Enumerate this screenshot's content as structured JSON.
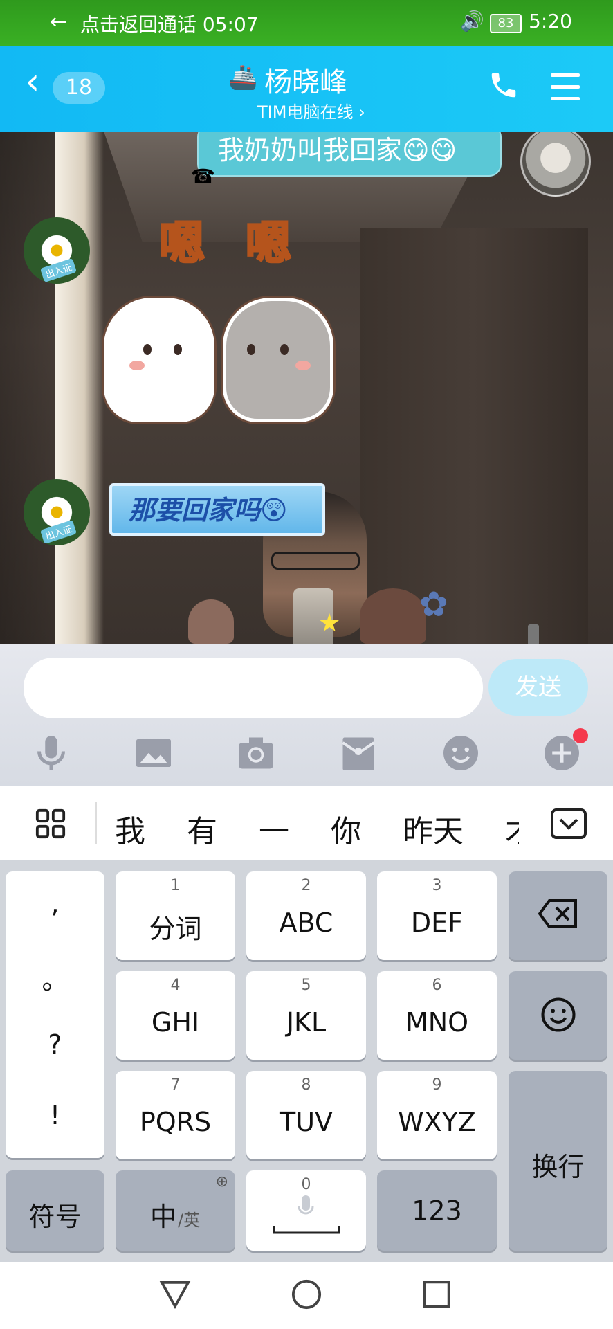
{
  "status_bar": {
    "call_back": "点击返回通话 05:07",
    "battery": "83",
    "time": "5:20"
  },
  "header": {
    "unread_count": "18",
    "contact_name": "杨晓峰",
    "subtitle": "TIM电脑在线 ›"
  },
  "messages": [
    {
      "from": "me",
      "type": "text",
      "text": "我奶奶叫我回家😋😋"
    },
    {
      "from": "contact",
      "type": "sticker",
      "caption": "嗯 嗯",
      "avatar_tag": "出入证"
    },
    {
      "from": "contact",
      "type": "sticker-text",
      "text": "那要回家吗😲",
      "avatar_tag": "出入证"
    }
  ],
  "composer": {
    "input_value": "",
    "send_label": "发送"
  },
  "toolbar": [
    "microphone-icon",
    "image-icon",
    "camera-icon",
    "red-packet-icon",
    "emoji-icon",
    "plus-icon"
  ],
  "candidates": [
    "我",
    "有",
    "一",
    "你",
    "昨天",
    "才"
  ],
  "keyboard": {
    "punct": [
      ",",
      "。",
      "?",
      "!"
    ],
    "keys": [
      {
        "num": "1",
        "label": "分词"
      },
      {
        "num": "2",
        "label": "ABC"
      },
      {
        "num": "3",
        "label": "DEF"
      },
      {
        "num": "4",
        "label": "GHI"
      },
      {
        "num": "5",
        "label": "JKL"
      },
      {
        "num": "6",
        "label": "MNO"
      },
      {
        "num": "7",
        "label": "PQRS"
      },
      {
        "num": "8",
        "label": "TUV"
      },
      {
        "num": "9",
        "label": "WXYZ"
      }
    ],
    "symbols": "符号",
    "lang_main": "中",
    "lang_alt": "/英",
    "space_num": "0",
    "num_key": "123",
    "enter": "换行"
  }
}
